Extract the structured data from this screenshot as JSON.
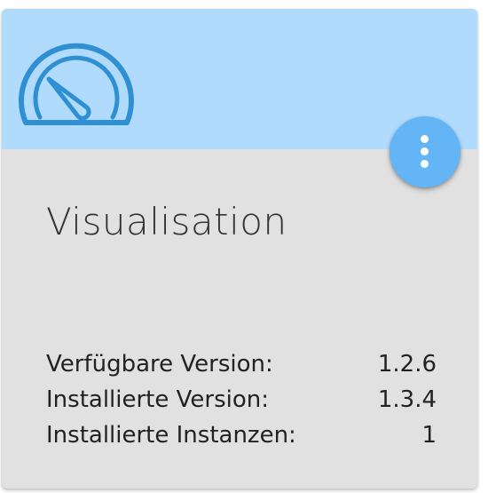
{
  "card": {
    "title": "Visualisation",
    "logo_icon": "gauge-icon",
    "menu_icon": "more-vertical-icon",
    "header_color": "#b1dbfd",
    "accent_color": "#64b5f6",
    "info": [
      {
        "label": "Verfügbare Version:",
        "value": "1.2.6"
      },
      {
        "label": "Installierte Version:",
        "value": "1.3.4"
      },
      {
        "label": "Installierte Instanzen:",
        "value": "1"
      }
    ]
  }
}
